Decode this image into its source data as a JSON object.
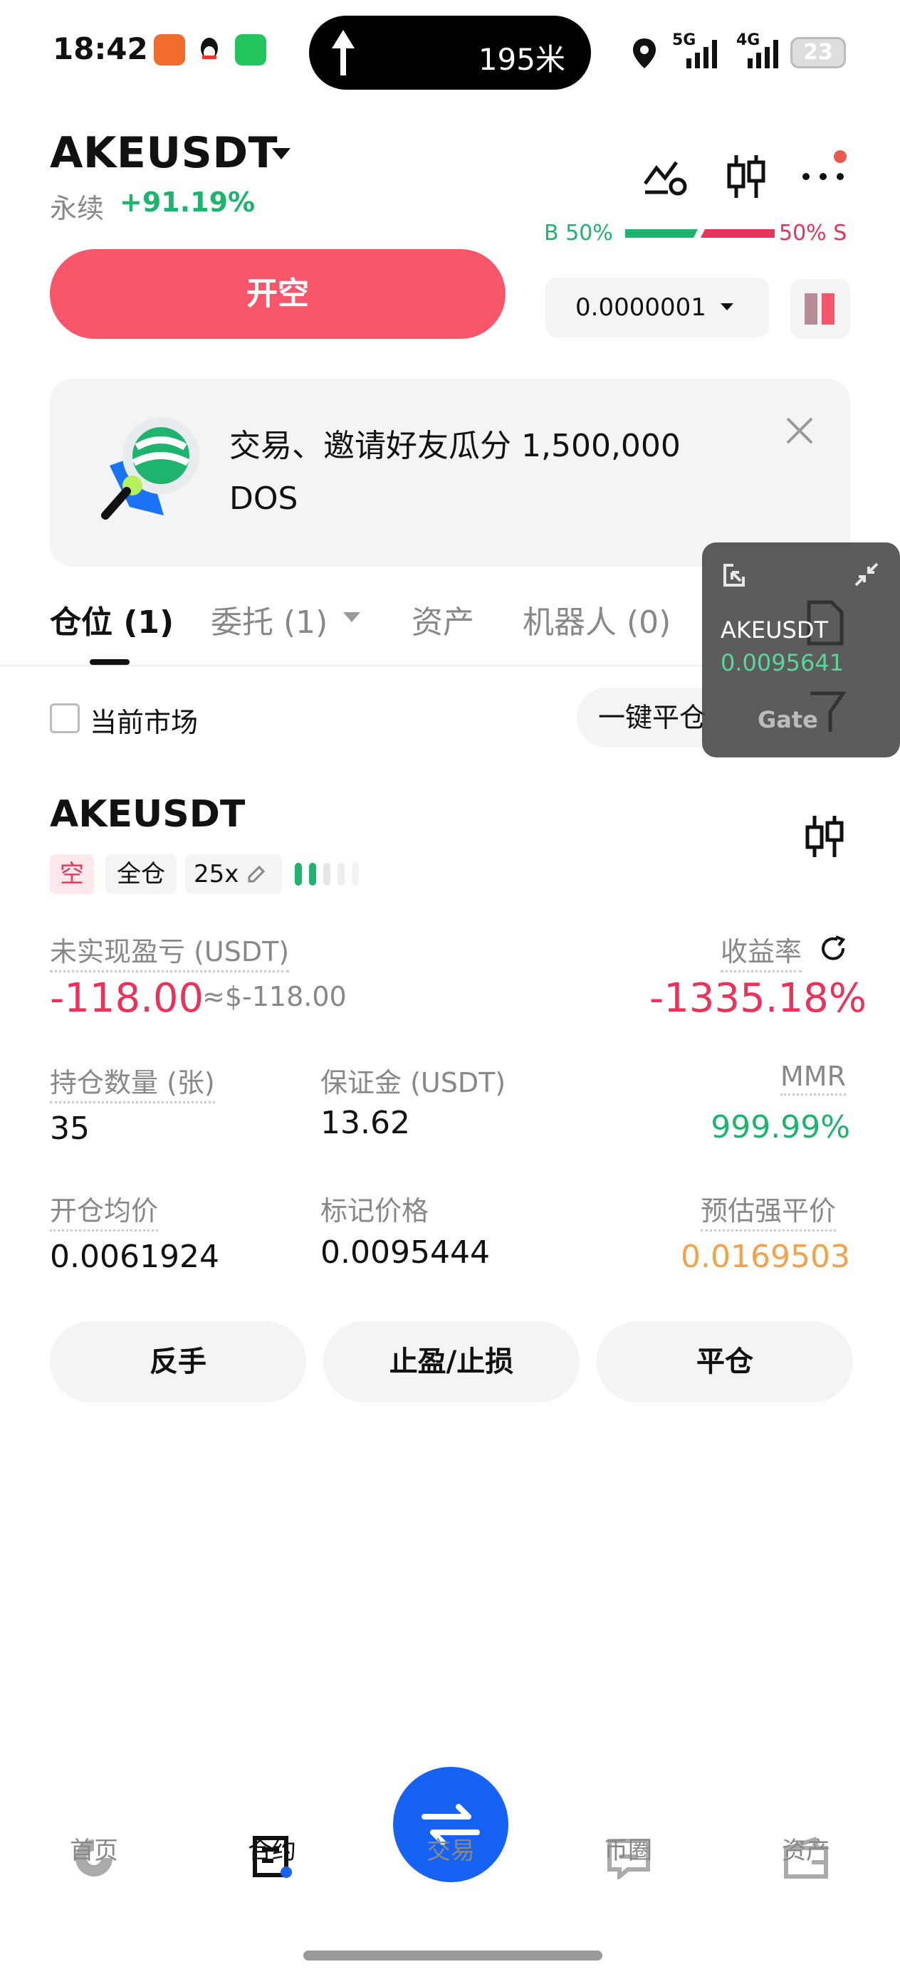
{
  "status_bar": {
    "time": "18:42",
    "nav_distance": "195米",
    "signal_1": "5G",
    "signal_2": "4G",
    "battery": "23"
  },
  "header": {
    "pair": "AKEUSDT",
    "contract_type": "永续",
    "change": "+91.19%",
    "long_ratio": "B 50%",
    "short_ratio": "50% S",
    "open_button": "开空",
    "tick_size": "0.0000001"
  },
  "banner": {
    "text": "交易、邀请好友瓜分 1,500,000 DOS"
  },
  "tabs": [
    {
      "label": "仓位 (1)"
    },
    {
      "label": "委托 (1)"
    },
    {
      "label": "资产"
    },
    {
      "label": "机器人 (0)"
    }
  ],
  "floating_widget": {
    "pair": "AKEUSDT",
    "price": "0.0095641",
    "brand": "Gate"
  },
  "filter": {
    "current_market_label": "当前市场",
    "close_all_label": "一键平仓"
  },
  "position": {
    "pair": "AKEUSDT",
    "side_tag": "空",
    "margin_mode": "全仓",
    "leverage": "25x",
    "pnl_label": "未实现盈亏 (USDT)",
    "pnl_value": "-118.00",
    "pnl_approx": "≈$-118.00",
    "roe_label": "收益率",
    "roe_value": "-1335.18%",
    "size_label": "持仓数量 (张)",
    "size_value": "35",
    "margin_label": "保证金 (USDT)",
    "margin_value": "13.62",
    "mmr_label": "MMR",
    "mmr_value": "999.99%",
    "entry_label": "开仓均价",
    "entry_value": "0.0061924",
    "mark_label": "标记价格",
    "mark_value": "0.0095444",
    "liq_label": "预估强平价",
    "liq_value": "0.0169503",
    "btn_reverse": "反手",
    "btn_tpsl": "止盈/止损",
    "btn_close": "平仓"
  },
  "bottom_nav": {
    "home": "首页",
    "contract": "合约",
    "trade": "交易",
    "community": "币圈",
    "assets": "资产"
  },
  "colors": {
    "accent_red": "#f7566a",
    "loss_red": "#e8345a",
    "gain_green": "#1fb46e",
    "warn_orange": "#f5a149",
    "brand_blue": "#1662f5"
  }
}
